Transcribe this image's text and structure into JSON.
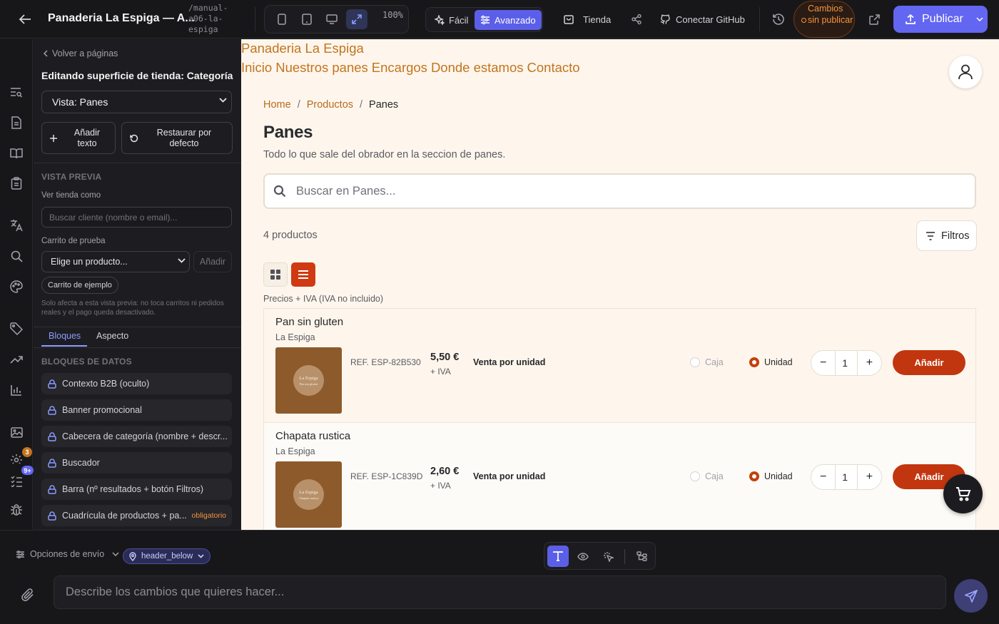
{
  "topbar": {
    "title": "Panaderia La Espiga — A...",
    "slug": "/manual-a06-la-espiga",
    "zoom": "100%",
    "modes": [
      "Fácil",
      "Avanzado"
    ],
    "active_mode": "Avanzado",
    "store_label": "Tienda",
    "github_label": "Conectar GitHub",
    "unsaved_label": "Cambios sin publicar",
    "publish_label": "Publicar"
  },
  "rail": {
    "icons": [
      "search-list-icon",
      "document-icon",
      "book-icon",
      "clipboard-icon",
      "translate-icon",
      "search-icon",
      "palette-icon",
      "tag-icon",
      "trending-icon",
      "bar-chart-icon",
      "image-icon",
      "settings-icon",
      "checklist-icon",
      "bug-icon"
    ],
    "badges": {
      "settings": "3",
      "checklist": "9+"
    }
  },
  "panel": {
    "back_label": "Volver a páginas",
    "heading": "Editando superficie de tienda: Categoría",
    "view_select": "Vista: Panes",
    "add_text_label": "Añadir texto",
    "restore_label": "Restaurar por defecto",
    "preview_section": "VISTA PREVIA",
    "view_as_label": "Ver tienda como",
    "customer_placeholder": "Buscar cliente (nombre o email)...",
    "test_cart_label": "Carrito de prueba",
    "product_select": "Elige un producto...",
    "add_label": "Añadir",
    "sample_cart_label": "Carrito de ejemplo",
    "note": "Solo afecta a esta vista previa: no toca carritos ni pedidos reales y el pago queda desactivado.",
    "tabs": [
      "Bloques",
      "Aspecto"
    ],
    "active_tab": "Bloques",
    "blocks_section": "BLOQUES DE DATOS",
    "blocks": [
      {
        "label": "Contexto B2B (oculto)",
        "tag": ""
      },
      {
        "label": "Banner promocional",
        "tag": ""
      },
      {
        "label": "Cabecera de categoría (nombre + descr...",
        "tag": ""
      },
      {
        "label": "Buscador",
        "tag": ""
      },
      {
        "label": "Barra (nº resultados + botón Filtros)",
        "tag": ""
      },
      {
        "label": "Cuadrícula de productos + pa...",
        "tag": "obligatorio"
      }
    ]
  },
  "site": {
    "brand": "Panaderia La Espiga",
    "nav": [
      "Inicio",
      "Nuestros panes",
      "Encargos",
      "Donde estamos",
      "Contacto"
    ],
    "breadcrumbs": [
      "Home",
      "Productos",
      "Panes"
    ],
    "heading": "Panes",
    "subtitle": "Todo lo que sale del obrador en la seccion de panes.",
    "search_placeholder": "Buscar en Panes...",
    "count": "4 productos",
    "filters_label": "Filtros",
    "prices_note": "Precios + IVA (IVA no incluido)",
    "products": [
      {
        "name": "Pan sin gluten",
        "brand": "La Espiga",
        "img_name": "La Espiga",
        "img_sub": "Pan sin gluten",
        "ref": "REF. ESP-82B530",
        "price": "5,50 €",
        "tax": "+ IVA",
        "sale_unit": "Venta por unidad",
        "opt_box": "Caja",
        "opt_unit": "Unidad",
        "qty": "1",
        "add": "Añadir"
      },
      {
        "name": "Chapata rustica",
        "brand": "La Espiga",
        "img_name": "La Espiga",
        "img_sub": "Chapata rustica",
        "ref": "REF. ESP-1C839D",
        "price": "2,60 €",
        "tax": "+ IVA",
        "sale_unit": "Venta por unidad",
        "opt_box": "Caja",
        "opt_unit": "Unidad",
        "qty": "1",
        "add": "Añadir"
      }
    ]
  },
  "bottom": {
    "send_options_label": "Opciones de envío",
    "location_tag": "header_below",
    "input_placeholder": "Describe los cambios que quieres hacer..."
  },
  "colors": {
    "accent": "#6366f1",
    "brand": "#c2741f",
    "add_button": "#c2360f",
    "warning": "#f5943d"
  }
}
